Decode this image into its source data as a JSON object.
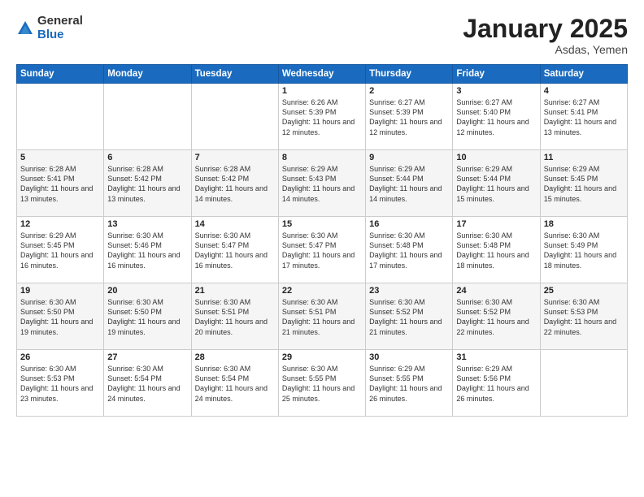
{
  "logo": {
    "general": "General",
    "blue": "Blue"
  },
  "header": {
    "month": "January 2025",
    "location": "Asdas, Yemen"
  },
  "days": [
    "Sunday",
    "Monday",
    "Tuesday",
    "Wednesday",
    "Thursday",
    "Friday",
    "Saturday"
  ],
  "weeks": [
    [
      {
        "day": "",
        "content": ""
      },
      {
        "day": "",
        "content": ""
      },
      {
        "day": "",
        "content": ""
      },
      {
        "day": "1",
        "content": "Sunrise: 6:26 AM\nSunset: 5:39 PM\nDaylight: 11 hours and 12 minutes."
      },
      {
        "day": "2",
        "content": "Sunrise: 6:27 AM\nSunset: 5:39 PM\nDaylight: 11 hours and 12 minutes."
      },
      {
        "day": "3",
        "content": "Sunrise: 6:27 AM\nSunset: 5:40 PM\nDaylight: 11 hours and 12 minutes."
      },
      {
        "day": "4",
        "content": "Sunrise: 6:27 AM\nSunset: 5:41 PM\nDaylight: 11 hours and 13 minutes."
      }
    ],
    [
      {
        "day": "5",
        "content": "Sunrise: 6:28 AM\nSunset: 5:41 PM\nDaylight: 11 hours and 13 minutes."
      },
      {
        "day": "6",
        "content": "Sunrise: 6:28 AM\nSunset: 5:42 PM\nDaylight: 11 hours and 13 minutes."
      },
      {
        "day": "7",
        "content": "Sunrise: 6:28 AM\nSunset: 5:42 PM\nDaylight: 11 hours and 14 minutes."
      },
      {
        "day": "8",
        "content": "Sunrise: 6:29 AM\nSunset: 5:43 PM\nDaylight: 11 hours and 14 minutes."
      },
      {
        "day": "9",
        "content": "Sunrise: 6:29 AM\nSunset: 5:44 PM\nDaylight: 11 hours and 14 minutes."
      },
      {
        "day": "10",
        "content": "Sunrise: 6:29 AM\nSunset: 5:44 PM\nDaylight: 11 hours and 15 minutes."
      },
      {
        "day": "11",
        "content": "Sunrise: 6:29 AM\nSunset: 5:45 PM\nDaylight: 11 hours and 15 minutes."
      }
    ],
    [
      {
        "day": "12",
        "content": "Sunrise: 6:29 AM\nSunset: 5:45 PM\nDaylight: 11 hours and 16 minutes."
      },
      {
        "day": "13",
        "content": "Sunrise: 6:30 AM\nSunset: 5:46 PM\nDaylight: 11 hours and 16 minutes."
      },
      {
        "day": "14",
        "content": "Sunrise: 6:30 AM\nSunset: 5:47 PM\nDaylight: 11 hours and 16 minutes."
      },
      {
        "day": "15",
        "content": "Sunrise: 6:30 AM\nSunset: 5:47 PM\nDaylight: 11 hours and 17 minutes."
      },
      {
        "day": "16",
        "content": "Sunrise: 6:30 AM\nSunset: 5:48 PM\nDaylight: 11 hours and 17 minutes."
      },
      {
        "day": "17",
        "content": "Sunrise: 6:30 AM\nSunset: 5:48 PM\nDaylight: 11 hours and 18 minutes."
      },
      {
        "day": "18",
        "content": "Sunrise: 6:30 AM\nSunset: 5:49 PM\nDaylight: 11 hours and 18 minutes."
      }
    ],
    [
      {
        "day": "19",
        "content": "Sunrise: 6:30 AM\nSunset: 5:50 PM\nDaylight: 11 hours and 19 minutes."
      },
      {
        "day": "20",
        "content": "Sunrise: 6:30 AM\nSunset: 5:50 PM\nDaylight: 11 hours and 19 minutes."
      },
      {
        "day": "21",
        "content": "Sunrise: 6:30 AM\nSunset: 5:51 PM\nDaylight: 11 hours and 20 minutes."
      },
      {
        "day": "22",
        "content": "Sunrise: 6:30 AM\nSunset: 5:51 PM\nDaylight: 11 hours and 21 minutes."
      },
      {
        "day": "23",
        "content": "Sunrise: 6:30 AM\nSunset: 5:52 PM\nDaylight: 11 hours and 21 minutes."
      },
      {
        "day": "24",
        "content": "Sunrise: 6:30 AM\nSunset: 5:52 PM\nDaylight: 11 hours and 22 minutes."
      },
      {
        "day": "25",
        "content": "Sunrise: 6:30 AM\nSunset: 5:53 PM\nDaylight: 11 hours and 22 minutes."
      }
    ],
    [
      {
        "day": "26",
        "content": "Sunrise: 6:30 AM\nSunset: 5:53 PM\nDaylight: 11 hours and 23 minutes."
      },
      {
        "day": "27",
        "content": "Sunrise: 6:30 AM\nSunset: 5:54 PM\nDaylight: 11 hours and 24 minutes."
      },
      {
        "day": "28",
        "content": "Sunrise: 6:30 AM\nSunset: 5:54 PM\nDaylight: 11 hours and 24 minutes."
      },
      {
        "day": "29",
        "content": "Sunrise: 6:30 AM\nSunset: 5:55 PM\nDaylight: 11 hours and 25 minutes."
      },
      {
        "day": "30",
        "content": "Sunrise: 6:29 AM\nSunset: 5:55 PM\nDaylight: 11 hours and 26 minutes."
      },
      {
        "day": "31",
        "content": "Sunrise: 6:29 AM\nSunset: 5:56 PM\nDaylight: 11 hours and 26 minutes."
      },
      {
        "day": "",
        "content": ""
      }
    ]
  ]
}
